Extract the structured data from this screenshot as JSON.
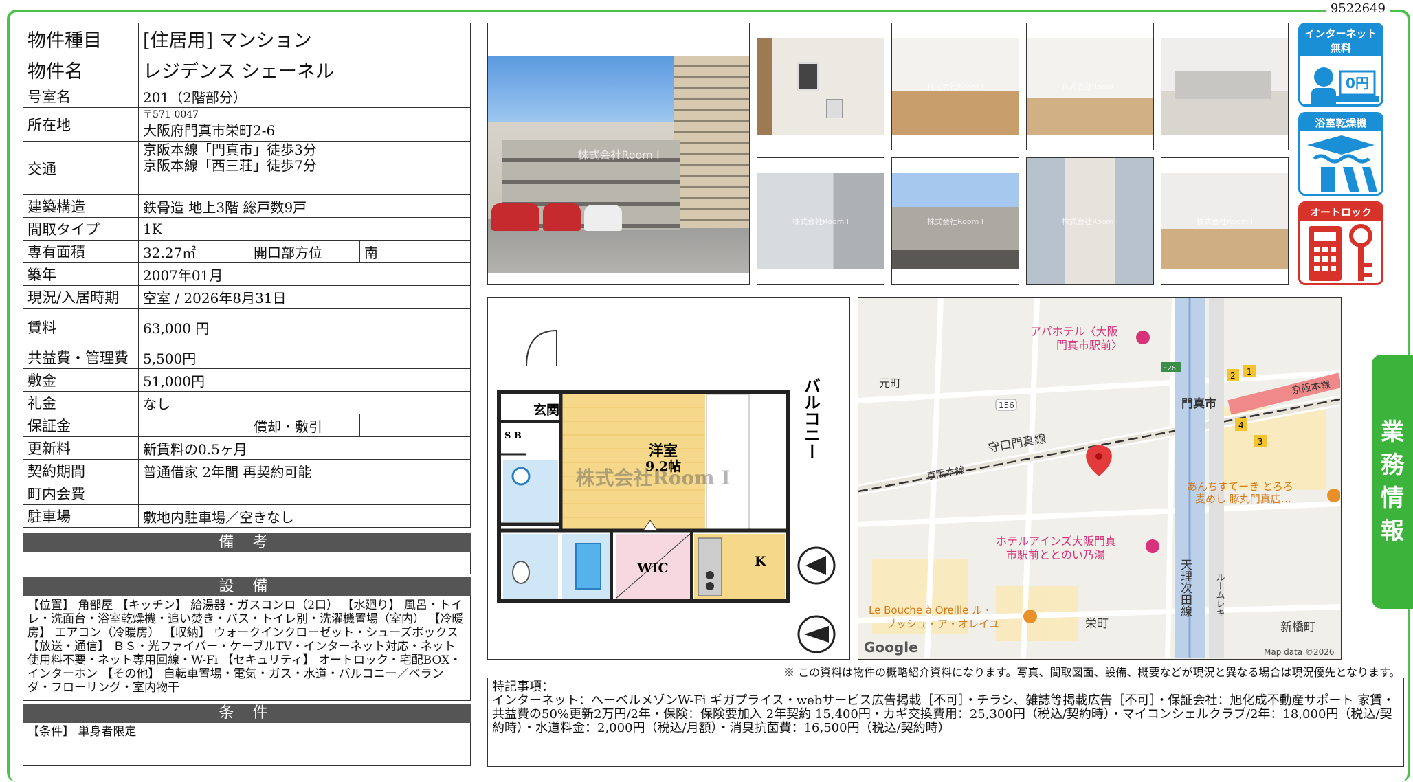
{
  "doc_id": "9522649",
  "info": {
    "type_label": "物件種目",
    "type_value": "[住居用] マンション",
    "name_label": "物件名",
    "name_value": "レジデンス シェーネル",
    "room_label": "号室名",
    "room_value": "201（2階部分）",
    "address_label": "所在地",
    "postal": "〒571-0047",
    "address": "大阪府門真市栄町2-6",
    "traffic_label": "交通",
    "traffic_1": "京阪本線「門真市」徒歩3分",
    "traffic_2": "京阪本線「西三荘」徒歩7分",
    "structure_label": "建築構造",
    "structure_value": "鉄骨造 地上3階 総戸数9戸",
    "layout_label": "間取タイプ",
    "layout_value": "1K",
    "area_label": "専有面積",
    "area_value": "32.27㎡",
    "direction_label": "開口部方位",
    "direction_value": "南",
    "built_label": "築年",
    "built_value": "2007年01月",
    "status_label": "現況/入居時期",
    "status_value": "空室 / 2026年8月31日",
    "rent_label": "賃料",
    "rent_value": "63,000 円",
    "fee_label": "共益費・管理費",
    "fee_value": "5,500円",
    "deposit_label": "敷金",
    "deposit_value": "51,000円",
    "keymoney_label": "礼金",
    "keymoney_value": "なし",
    "guarantee_label": "保証金",
    "guarantee_value": "",
    "amort_label": "償却・敷引",
    "amort_value": "",
    "renewal_label": "更新料",
    "renewal_value": "新賃料の0.5ヶ月",
    "contract_label": "契約期間",
    "contract_value": "普通借家 2年間 再契約可能",
    "town_label": "町内会費",
    "town_value": "",
    "parking_label": "駐車場",
    "parking_value": "敷地内駐車場／空きなし"
  },
  "remarks": {
    "title": "備 考",
    "text": ""
  },
  "equipment": {
    "title": "設 備",
    "text": "【位置】 角部屋 【キッチン】 給湯器・ガスコンロ（2口） 【水廻り】 風呂・トイレ・洗面台・浴室乾燥機・追い焚き・バス・トイレ別・洗濯機置場（室内） 【冷暖房】 エアコン（冷暖房） 【収納】 ウォークインクローゼット・シューズボックス 【放送・通信】 ＢＳ・光ファイバー・ケーブルTV・インターネット対応・ネット使用料不要・ネット専用回線・W-Fi 【セキュリティ】 オートロック・宅配BOX・インターホン 【その他】 自転車置場・電気・ガス・水道・バルコニー／ベランダ・フローリング・室内物干"
  },
  "conditions": {
    "title": "条 件",
    "text": "【条件】 単身者限定"
  },
  "photos": {
    "watermark": "株式会社Room I"
  },
  "badges": {
    "internet": "インターネット無料",
    "internet_price": "0円",
    "bath": "浴室乾燥機",
    "autolock": "オートロック"
  },
  "side_tab": {
    "c1": "業",
    "c2": "務",
    "c3": "情",
    "c4": "報"
  },
  "floorplan": {
    "genkan": "玄関",
    "sb": "S B",
    "room": "洋室",
    "size": "9.2帖",
    "wic": "WIC",
    "k": "K",
    "balcony": "バルコニー",
    "watermark": "株式会社Room I"
  },
  "map": {
    "apa": "アパホテル〈大阪",
    "apa2": "門真市駅前〉",
    "motomachi": "元町",
    "e26": "E26",
    "r156": "156",
    "moriguchi": "守口門真線",
    "keihan": "京阪本線",
    "keihan2": "京阪本線",
    "station": "門真市",
    "anchi": "あんちすてーき とろろ",
    "anchi2": "麦めし 豚丸門真店…",
    "inns": "ホテルアインズ大阪門真",
    "inns2": "市駅前ととのい乃湯",
    "tenri": "天理次田線",
    "monorail": "ルームレキ",
    "lebouche": "Le Bouche à Oreille ル・",
    "lebouche2": "ブッシュ・ア・オレイユ",
    "sakae": "栄町",
    "shinbashi": "新橋町",
    "google": "Google",
    "mapdata": "Map data ©2026",
    "n1": "1",
    "n2": "2",
    "n3": "3",
    "n4": "4"
  },
  "disclaimer": "※ この資料は物件の概略紹介資料になります。写真、間取図面、設備、概要などが現況と異なる場合は現況優先となります。",
  "notes": {
    "title": "特記事項：",
    "text": "インターネット：ヘーベルメゾンW-Fi ギガプライス・webサービス広告掲載［不可］・チラシ、雑誌等掲載広告［不可］・保証会社：旭化成不動産サポート 家賃・共益費の50%更新2万円/2年・保険：保険要加入 2年契約 15,400円・カギ交換費用：25,300円（税込/契約時）・マイコンシェルクラブ/2年：18,000円（税込/契約時）・水道料金：2,000円（税込/月額）・消臭抗菌費：16,500円（税込/契約時）"
  }
}
